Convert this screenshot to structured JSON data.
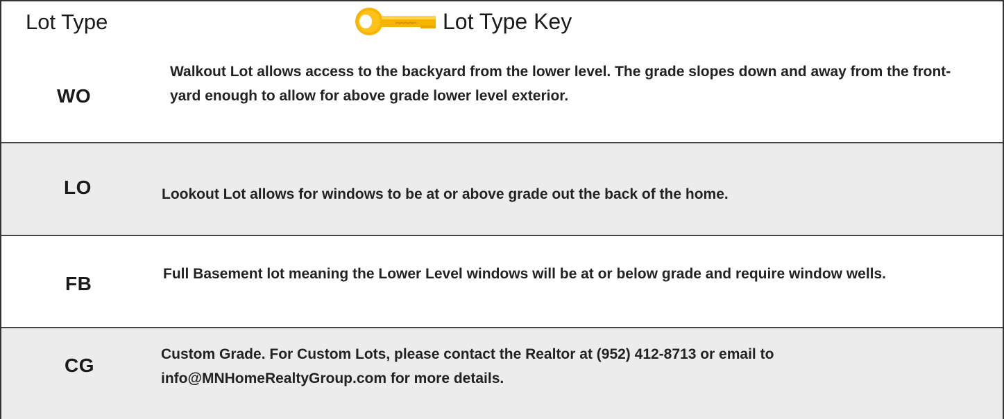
{
  "header": {
    "left_label": "Lot Type",
    "title": "Lot Type Key",
    "icon": "key-icon"
  },
  "rows": [
    {
      "code": "WO",
      "description": "Walkout Lot allows access to the backyard from the lower level. The grade slopes down and away from the front-yard enough to allow for above grade lower level exterior."
    },
    {
      "code": "LO",
      "description": "Lookout Lot allows for windows to be at or above grade out the back of the home."
    },
    {
      "code": "FB",
      "description": "Full Basement lot meaning the Lower Level windows will be at or below grade and require window wells."
    },
    {
      "code": "CG",
      "description": "Custom Grade. For Custom Lots, please contact the Realtor at (952) 412-8713 or email to info@MNHomeRealtyGroup.com for more details."
    }
  ],
  "colors": {
    "key_gold": "#f5b800",
    "row_gray": "#ececec",
    "border": "#333333"
  }
}
